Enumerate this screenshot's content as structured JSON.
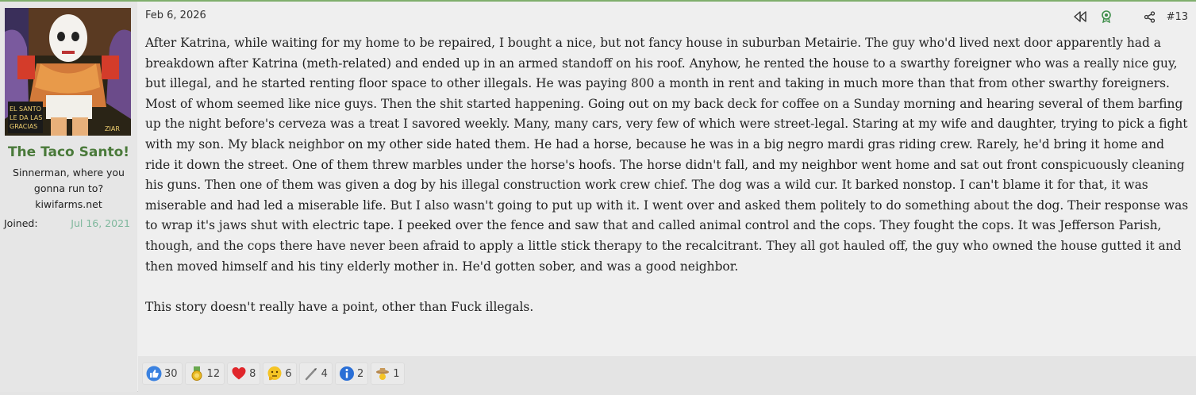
{
  "user": {
    "name": "The Taco Santo!",
    "title": "Sinnerman, where you gonna run to?",
    "site": "kiwifarms.net",
    "joined_label": "Joined:",
    "joined_date": "Jul 16, 2021",
    "avatar_text": "EL SANTO LE DA LAS GRACIAS"
  },
  "post": {
    "date": "Feb 6, 2026",
    "number": "#13",
    "paragraphs": [
      "After Katrina, while waiting for my home to be repaired, I bought a nice, but not fancy house in suburban Metairie. The guy who'd lived next door apparently had a breakdown after Katrina (meth-related) and ended up in an armed standoff on his roof. Anyhow, he rented the house to a swarthy foreigner who was a really nice guy, but illegal, and he started renting floor space to other illegals. He was paying 800 a month in rent and taking in much more than that from other swarthy foreigners. Most of whom seemed like nice guys. Then the shit started happening. Going out on my back deck for coffee on a Sunday morning and hearing several of them barfing up the night before's cerveza was a treat I savored weekly. Many, many cars, very few of which were street-legal. Staring at my wife and daughter, trying to pick a fight with my son. My black neighbor on my other side hated them. He had a horse, because he was in a big negro mardi gras riding crew. Rarely, he'd bring it home and ride it down the street. One of them threw marbles under the horse's hoofs. The horse didn't fall, and my neighbor went home and sat out front conspicuously cleaning his guns. Then one of them was given a dog by his illegal construction work crew chief. The dog was a wild cur. It barked nonstop. I can't blame it for that, it was miserable and had led a miserable life. But I also wasn't going to put up with it. I went over and asked them politely to do something about the dog. Their response was to wrap it's jaws shut with electric tape. I peeked over the fence and saw that and called animal control and the cops. They fought the cops. It was Jefferson Parish, though, and the cops there have never been afraid to apply a little stick therapy to the recalcitrant. They all got hauled off, the guy who owned the house gutted it and then moved himself and his tiny elderly mother in. He'd gotten sober, and was a good neighbor.",
      "This story doesn't really have a point, other than Fuck illegals."
    ]
  },
  "reactions": [
    {
      "icon": "thumbs-up-icon",
      "count": "30"
    },
    {
      "icon": "medal-icon",
      "count": "12"
    },
    {
      "icon": "heart-icon",
      "count": "8"
    },
    {
      "icon": "thinking-face-icon",
      "count": "6"
    },
    {
      "icon": "wand-icon",
      "count": "4"
    },
    {
      "icon": "info-icon",
      "count": "2"
    },
    {
      "icon": "hat-tip-icon",
      "count": "1"
    }
  ],
  "colors": {
    "username": "#4a7a3a",
    "joined_date": "#7fb89d",
    "accent_border": "#7fae6c"
  }
}
